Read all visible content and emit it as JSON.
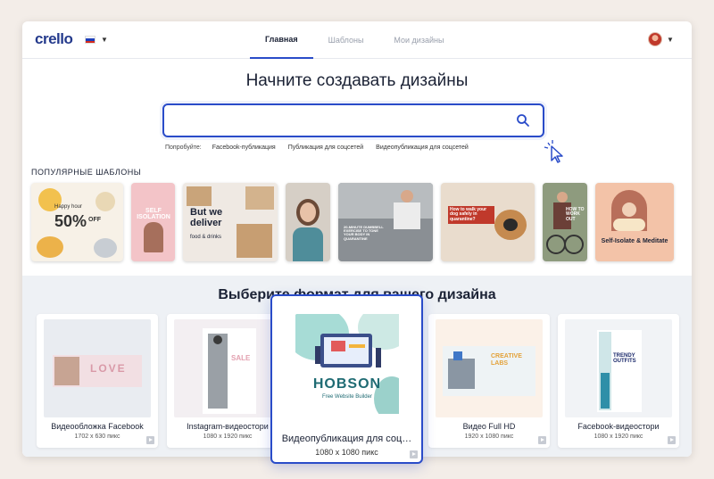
{
  "header": {
    "logo": "crello",
    "nav": [
      "Главная",
      "Шаблоны",
      "Мои дизайны"
    ]
  },
  "hero": {
    "title": "Начните создавать дизайны",
    "search_placeholder": "",
    "try_label": "Попробуйте:",
    "suggestions": [
      "Facebook-публикация",
      "Публикация для соцсетей",
      "Видеопубликация для соцсетей"
    ]
  },
  "templates": {
    "title": "ПОПУЛЯРНЫЕ ШАБЛОНЫ",
    "texts": {
      "happy_hour": "Happy hour",
      "sale_pct": "50%",
      "off": "OFF",
      "self_isolation": "SELF ISOLATION",
      "deliver": "But we deliver",
      "food": "food & drinks",
      "dumbbell": "20-MINUTE DUMBBELL EXERCISE TO TONE YOUR BODY IN QUARANTINE",
      "walk_dog": "How to walk your dog safely in quarantine?",
      "work_out": "HOW TO WORK OUT",
      "meditate": "Self-Isolate & Meditate"
    }
  },
  "formats": {
    "title": "Выберите формат для вашего дизайна",
    "cards": [
      {
        "name": "Видеообложка Facebook",
        "size": "1702 x 630 пикс",
        "thumb_text": "LOVE"
      },
      {
        "name": "Instagram-видеостори",
        "size": "1080 x 1920 пикс",
        "thumb_text": "SALE"
      },
      {
        "name": "Видеопубликация для соц…",
        "size": "1080 x 1080 пикс",
        "thumb_text": "HOBSON",
        "thumb_sub": "Free Website Builder"
      },
      {
        "name": "Видео Full HD",
        "size": "1920 x 1080 пикс",
        "thumb_text": "CREATIVE LABS"
      },
      {
        "name": "Facebook-видеостори",
        "size": "1080 x 1920 пикс",
        "thumb_text": "TRENDY OUTFITS"
      }
    ]
  },
  "colors": {
    "accent": "#2a4cc9",
    "logo": "#243a8c",
    "background": "#f3ede8"
  }
}
